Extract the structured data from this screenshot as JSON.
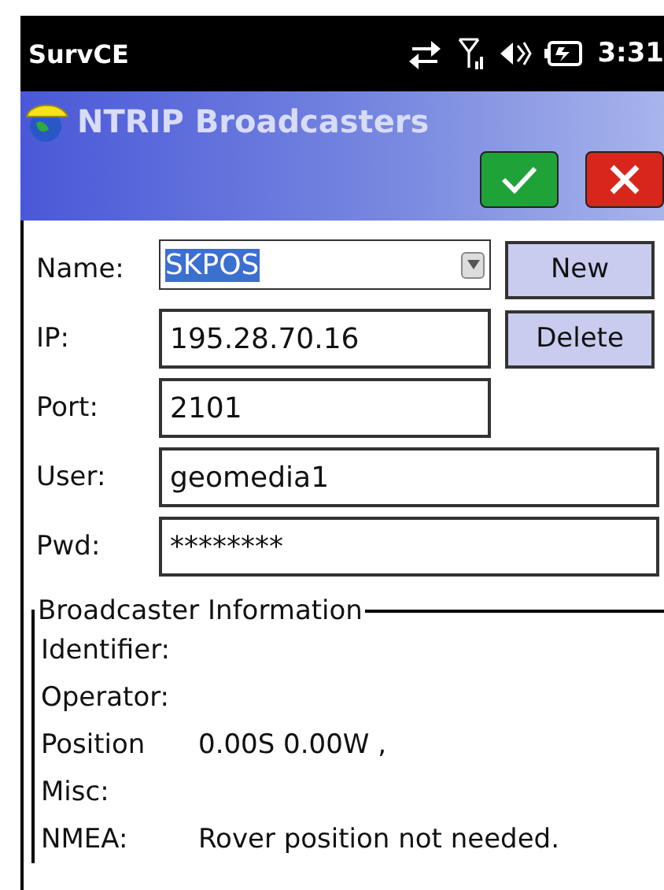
{
  "status_bar": {
    "app": "SurvCE",
    "time": "3:31"
  },
  "header": {
    "title": "NTRIP Broadcasters",
    "buttons": [
      {
        "kind": "ok"
      },
      {
        "kind": "cancel"
      }
    ]
  },
  "form": {
    "fields": [
      {
        "kind": "combo",
        "label": "Name:",
        "value": "SKPOS",
        "highlighted": true,
        "wide": false
      },
      {
        "kind": "text",
        "label": "IP:",
        "value": "195.28.70.16",
        "highlighted": false,
        "wide": false
      },
      {
        "kind": "text",
        "label": "Port:",
        "value": "2101",
        "highlighted": false,
        "wide": false
      },
      {
        "kind": "text",
        "label": "User:",
        "value": "geomedia1",
        "highlighted": false,
        "wide": true
      },
      {
        "kind": "text",
        "label": "Pwd:",
        "value": "********",
        "highlighted": false,
        "wide": true
      }
    ],
    "side_buttons": [
      "New",
      "Delete"
    ]
  },
  "info": {
    "title": "Broadcaster Information",
    "rows": [
      {
        "label": "Identifier:"
      },
      {
        "label": "Operator:"
      },
      {
        "label": "Position",
        "value": "0.00S 0.00W ,"
      },
      {
        "label": "Misc:"
      },
      {
        "label": "NMEA:",
        "value": "Rover position not needed."
      }
    ]
  }
}
